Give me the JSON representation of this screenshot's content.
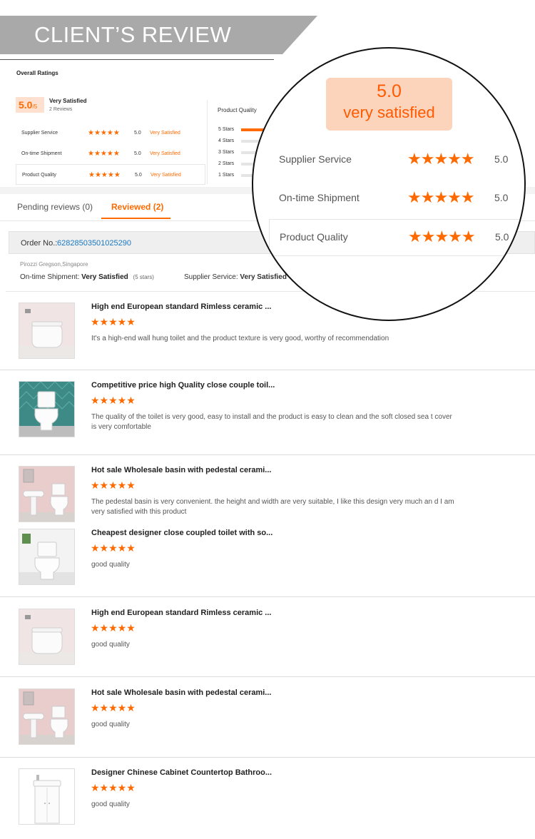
{
  "banner": {
    "title": "CLIENT’S REVIEW"
  },
  "overall": {
    "label": "Overall Ratings",
    "score": "5.0",
    "out_of": "/5",
    "satisfaction": "Very Satisfied",
    "reviews": "2 Reviews",
    "rows": [
      {
        "label": "Supplier Service",
        "stars": "★★★★★",
        "value": "5.0",
        "status": "Very Satisfied"
      },
      {
        "label": "On-time Shipment",
        "stars": "★★★★★",
        "value": "5.0",
        "status": "Very Satisfied"
      },
      {
        "label": "Product Quality",
        "stars": "★★★★★",
        "value": "5.0",
        "status": "Very Satisfied"
      }
    ],
    "product_quality_heading": "Product Quality",
    "distribution": [
      {
        "label": "5 Stars",
        "fraction": 1.0
      },
      {
        "label": "4 Stars",
        "fraction": 0
      },
      {
        "label": "3 Stars",
        "fraction": 0
      },
      {
        "label": "2 Stars",
        "fraction": 0
      },
      {
        "label": "1 Stars",
        "fraction": 0
      }
    ]
  },
  "tabs": {
    "pending": "Pending reviews (0)",
    "reviewed": "Reviewed (2)"
  },
  "order": {
    "label": "Order No.:",
    "number": "62828503501025290",
    "buyer": "Pirozzi Gregson,Singapore",
    "shipment_label": "On-time Shipment:",
    "shipment_value": "Very Satisfied",
    "shipment_stars": "(5 stars)",
    "supplier_label": "Supplier Service:",
    "supplier_value": "Very Satisfied"
  },
  "items": [
    {
      "title": "High end European standard Rimless ceramic ...",
      "stars": "★★★★★",
      "text": "It's a high-end wall hung toilet and the product texture is very good, worthy of recommendation",
      "thumb": "wall-hung-toilet"
    },
    {
      "title": "Competitive price high Quality close couple toil...",
      "stars": "★★★★★",
      "text": "The quality of the toilet is very good, easy to install and the product is easy to clean and the soft closed sea t cover  is very comfortable",
      "thumb": "close-couple-toilet"
    },
    {
      "title": "Hot sale Wholesale basin with pedestal cerami...",
      "stars": "★★★★★",
      "text": "The pedestal basin is very convenient. the height and width are very suitable, I like this design very much an d I am very satisfied with this product",
      "thumb": "pedestal-basin"
    },
    {
      "title": "Cheapest designer close coupled toilet with so...",
      "stars": "★★★★★",
      "text": "good quality",
      "thumb": "close-coupled-toilet"
    },
    {
      "title": "High end European standard Rimless ceramic ...",
      "stars": "★★★★★",
      "text": "good quality",
      "thumb": "wall-hung-toilet"
    },
    {
      "title": "Hot sale Wholesale basin with pedestal cerami...",
      "stars": "★★★★★",
      "text": "good quality",
      "thumb": "pedestal-basin"
    },
    {
      "title": "Designer Chinese Cabinet Countertop Bathroo...",
      "stars": "★★★★★",
      "text": "good quality",
      "thumb": "cabinet-basin"
    }
  ],
  "zoom": {
    "score": "5.0",
    "label": "very satisfied",
    "rows": [
      {
        "label": "Supplier Service",
        "stars": "★★★★★",
        "value": "5.0"
      },
      {
        "label": "On-time Shipment",
        "stars": "★★★★★",
        "value": "5.0"
      },
      {
        "label": "Product Quality",
        "stars": "★★★★★",
        "value": "5.0"
      }
    ]
  },
  "colors": {
    "accent": "#ff6a00",
    "link": "#1a78c2",
    "banner": "#a9a9a9",
    "zoom_badge": "#fcd3bb"
  }
}
